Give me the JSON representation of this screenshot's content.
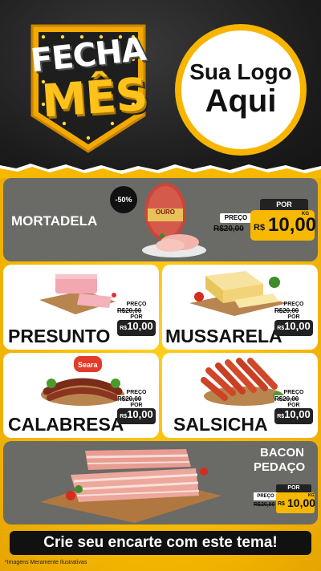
{
  "header": {
    "badge_line1": "FECHA",
    "badge_line2": "MÊS",
    "logo_line1": "Sua Logo",
    "logo_line2": "Aqui"
  },
  "mortadela": {
    "name": "MORTADELA",
    "discount": "-50%",
    "brand": "OURO",
    "preco_label": "PREÇO",
    "old_price": "R$20,00",
    "por_label": "POR",
    "currency": "R$",
    "price": "10,00",
    "unit": "KG"
  },
  "products": [
    {
      "name": "PRESUNTO",
      "preco_label": "PREÇO",
      "old_price": "R$20,00",
      "por_label": "POR",
      "currency": "R$",
      "price": "10,00",
      "unit": "KG"
    },
    {
      "name": "MUSSARELA",
      "preco_label": "PREÇO",
      "old_price": "R$20,00",
      "por_label": "POR",
      "currency": "R$",
      "price": "10,00",
      "unit": "KG"
    },
    {
      "name": "CALABRESA",
      "brand": "Seara",
      "preco_label": "PREÇO",
      "old_price": "R$20,00",
      "por_label": "POR",
      "currency": "R$",
      "price": "10,00",
      "unit": "KG"
    },
    {
      "name": "SALSICHA",
      "preco_label": "PREÇO",
      "old_price": "R$20,00",
      "por_label": "POR",
      "currency": "R$",
      "price": "10,00",
      "unit": "KG"
    }
  ],
  "bacon": {
    "name_line1": "BACON",
    "name_line2": "PEDAÇO",
    "preco_label": "PREÇO",
    "old_price": "R$20,00",
    "por_label": "POR",
    "currency": "R$",
    "price": "10,00",
    "unit": "KG"
  },
  "footer": {
    "cta": "Crie seu encarte com este tema!",
    "disclaimer": "*Imagens Meramente Ilustrativas"
  },
  "colors": {
    "accent": "#f6b800",
    "dark": "#1c1c1c",
    "card_dark": "#6a6a66"
  }
}
